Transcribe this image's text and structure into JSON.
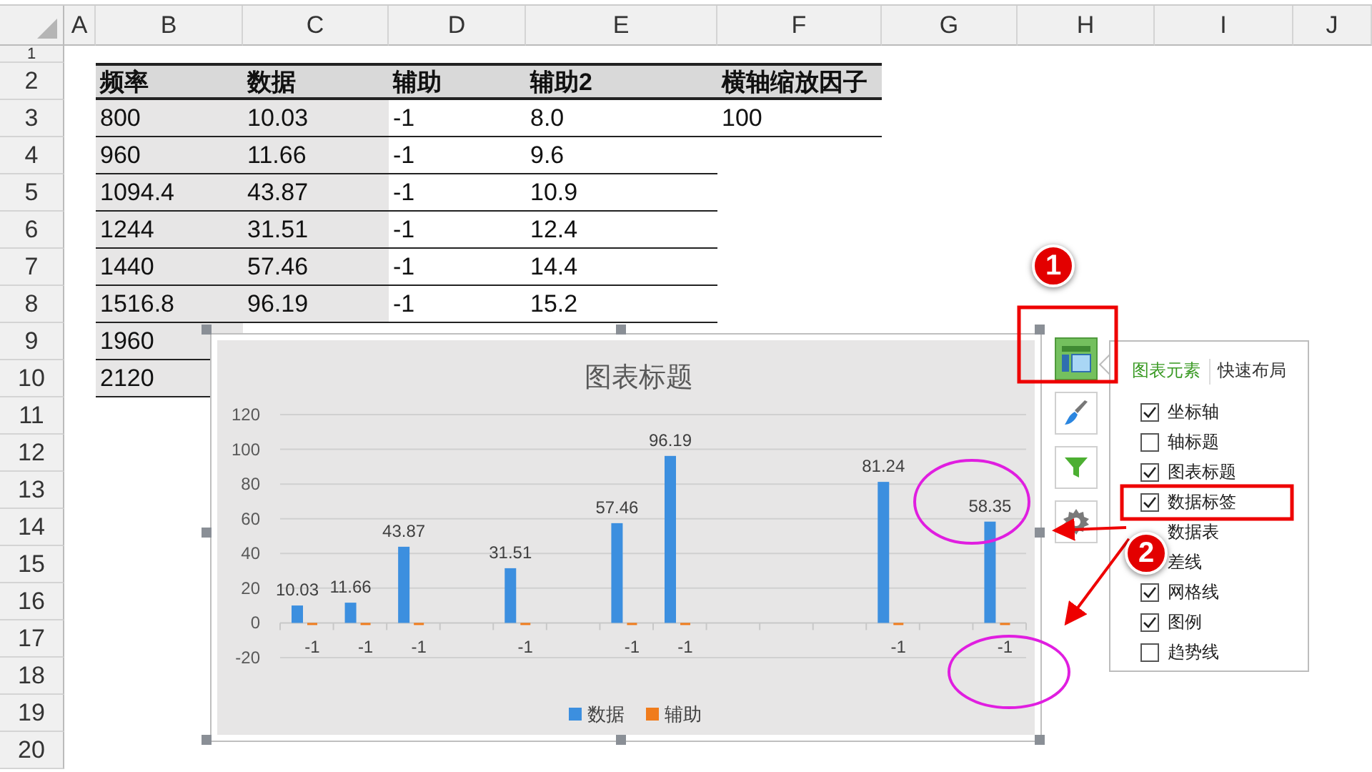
{
  "sheet": {
    "columns": [
      "A",
      "B",
      "C",
      "D",
      "E",
      "F",
      "G",
      "H",
      "I",
      "J"
    ],
    "rows": [
      "1",
      "2",
      "3",
      "4",
      "5",
      "6",
      "7",
      "8",
      "9",
      "10",
      "11",
      "12",
      "13",
      "14",
      "15",
      "16",
      "17",
      "18",
      "19",
      "20"
    ]
  },
  "table": {
    "header": [
      "频率",
      "数据",
      "辅助",
      "辅助2",
      "横轴缩放因子"
    ],
    "rows": [
      {
        "cells": [
          "800",
          "10.03",
          "-1",
          "8.0",
          "100"
        ]
      },
      {
        "cells": [
          "960",
          "11.66",
          "-1",
          "9.6"
        ]
      },
      {
        "cells": [
          "1094.4",
          "43.87",
          "-1",
          "10.9"
        ]
      },
      {
        "cells": [
          "1244",
          "31.51",
          "-1",
          "12.4"
        ]
      },
      {
        "cells": [
          "1440",
          "57.46",
          "-1",
          "14.4"
        ]
      },
      {
        "cells": [
          "1516.8",
          "96.19",
          "-1",
          "15.2"
        ]
      },
      {
        "cells": [
          "1960"
        ]
      },
      {
        "cells": [
          "2120"
        ]
      }
    ]
  },
  "chart": {
    "chart_data": {
      "type": "bar",
      "title": "图表标题",
      "ylim": [
        -20,
        120
      ],
      "yticks": [
        -20,
        0,
        20,
        40,
        60,
        80,
        100,
        120
      ],
      "data_labels": true,
      "grid": true,
      "legend": "bottom",
      "series": [
        {
          "name": "数据",
          "color": "#3c8fdf",
          "values": [
            10.03,
            11.66,
            43.87,
            null,
            31.51,
            null,
            57.46,
            96.19,
            null,
            null,
            null,
            81.24,
            null,
            58.35
          ]
        },
        {
          "name": "辅助",
          "color": "#f07c1c",
          "values": [
            -1,
            -1,
            -1,
            null,
            -1,
            null,
            -1,
            -1,
            null,
            null,
            null,
            -1,
            null,
            -1
          ]
        }
      ]
    }
  },
  "chart_tools": {
    "buttons": [
      {
        "kind": "elements",
        "selected": true
      },
      {
        "kind": "style",
        "selected": false
      },
      {
        "kind": "filter",
        "selected": false
      },
      {
        "kind": "settings",
        "selected": false
      }
    ],
    "tabs": [
      {
        "label": "图表元素",
        "selected": true
      },
      {
        "label": "快速布局",
        "selected": false
      }
    ],
    "items": [
      {
        "label": "坐标轴",
        "checked": true
      },
      {
        "label": "轴标题",
        "checked": false
      },
      {
        "label": "图表标题",
        "checked": true
      },
      {
        "label": "数据标签",
        "checked": true
      },
      {
        "label": "数据表"
      },
      {
        "label": "差线"
      },
      {
        "label": "网格线",
        "checked": true
      },
      {
        "label": "图例",
        "checked": true
      },
      {
        "label": "趋势线",
        "checked": false
      }
    ]
  },
  "callouts": [
    {
      "text": "1"
    },
    {
      "text": "2"
    }
  ]
}
